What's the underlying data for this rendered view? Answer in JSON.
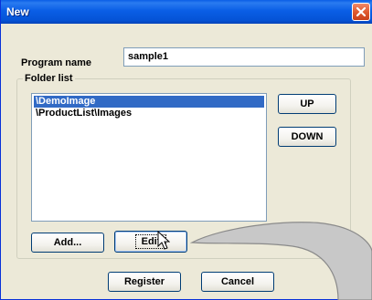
{
  "window": {
    "title": "New"
  },
  "form": {
    "program_name_label": "Program name",
    "program_name_value": "sample1",
    "folder_list_label": "Folder list"
  },
  "folders": [
    {
      "label": "\\DemoImage",
      "selected": true
    },
    {
      "label": "\\ProductList\\Images",
      "selected": false
    }
  ],
  "buttons": {
    "up": "UP",
    "down": "DOWN",
    "add": "Add...",
    "edit": "Edit",
    "register": "Register",
    "cancel": "Cancel"
  },
  "colors": {
    "titlebar": "#0a5ee6",
    "selection": "#316ac5",
    "callout": "#c8c8c8"
  }
}
